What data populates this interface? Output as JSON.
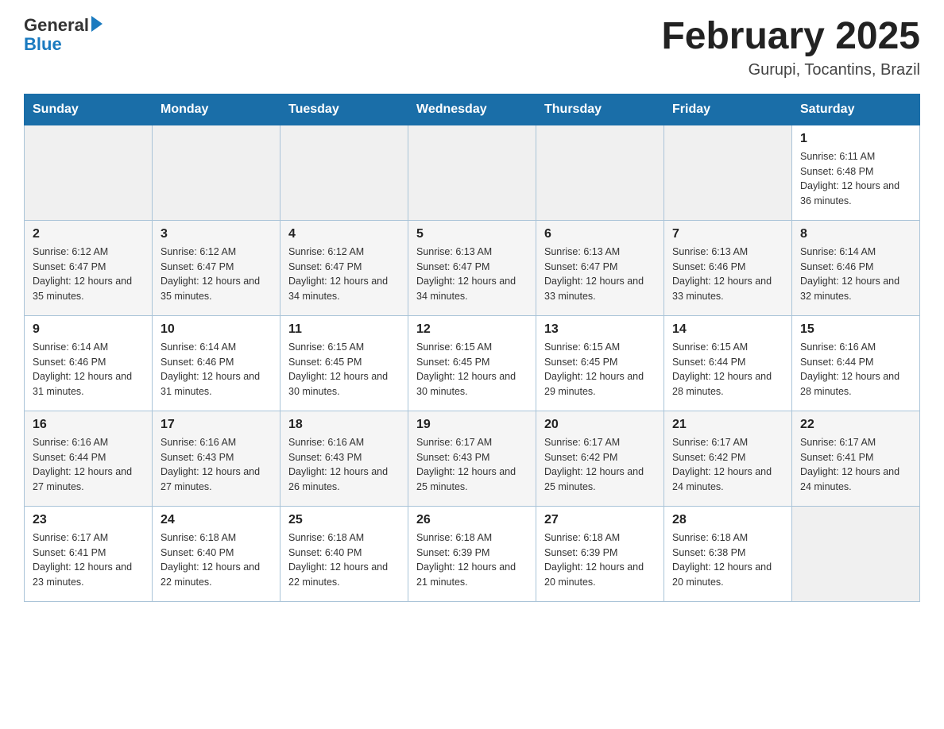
{
  "header": {
    "logo_general": "General",
    "logo_blue": "Blue",
    "month_title": "February 2025",
    "location": "Gurupi, Tocantins, Brazil"
  },
  "weekdays": [
    "Sunday",
    "Monday",
    "Tuesday",
    "Wednesday",
    "Thursday",
    "Friday",
    "Saturday"
  ],
  "weeks": [
    [
      {
        "day": "",
        "info": ""
      },
      {
        "day": "",
        "info": ""
      },
      {
        "day": "",
        "info": ""
      },
      {
        "day": "",
        "info": ""
      },
      {
        "day": "",
        "info": ""
      },
      {
        "day": "",
        "info": ""
      },
      {
        "day": "1",
        "info": "Sunrise: 6:11 AM\nSunset: 6:48 PM\nDaylight: 12 hours and 36 minutes."
      }
    ],
    [
      {
        "day": "2",
        "info": "Sunrise: 6:12 AM\nSunset: 6:47 PM\nDaylight: 12 hours and 35 minutes."
      },
      {
        "day": "3",
        "info": "Sunrise: 6:12 AM\nSunset: 6:47 PM\nDaylight: 12 hours and 35 minutes."
      },
      {
        "day": "4",
        "info": "Sunrise: 6:12 AM\nSunset: 6:47 PM\nDaylight: 12 hours and 34 minutes."
      },
      {
        "day": "5",
        "info": "Sunrise: 6:13 AM\nSunset: 6:47 PM\nDaylight: 12 hours and 34 minutes."
      },
      {
        "day": "6",
        "info": "Sunrise: 6:13 AM\nSunset: 6:47 PM\nDaylight: 12 hours and 33 minutes."
      },
      {
        "day": "7",
        "info": "Sunrise: 6:13 AM\nSunset: 6:46 PM\nDaylight: 12 hours and 33 minutes."
      },
      {
        "day": "8",
        "info": "Sunrise: 6:14 AM\nSunset: 6:46 PM\nDaylight: 12 hours and 32 minutes."
      }
    ],
    [
      {
        "day": "9",
        "info": "Sunrise: 6:14 AM\nSunset: 6:46 PM\nDaylight: 12 hours and 31 minutes."
      },
      {
        "day": "10",
        "info": "Sunrise: 6:14 AM\nSunset: 6:46 PM\nDaylight: 12 hours and 31 minutes."
      },
      {
        "day": "11",
        "info": "Sunrise: 6:15 AM\nSunset: 6:45 PM\nDaylight: 12 hours and 30 minutes."
      },
      {
        "day": "12",
        "info": "Sunrise: 6:15 AM\nSunset: 6:45 PM\nDaylight: 12 hours and 30 minutes."
      },
      {
        "day": "13",
        "info": "Sunrise: 6:15 AM\nSunset: 6:45 PM\nDaylight: 12 hours and 29 minutes."
      },
      {
        "day": "14",
        "info": "Sunrise: 6:15 AM\nSunset: 6:44 PM\nDaylight: 12 hours and 28 minutes."
      },
      {
        "day": "15",
        "info": "Sunrise: 6:16 AM\nSunset: 6:44 PM\nDaylight: 12 hours and 28 minutes."
      }
    ],
    [
      {
        "day": "16",
        "info": "Sunrise: 6:16 AM\nSunset: 6:44 PM\nDaylight: 12 hours and 27 minutes."
      },
      {
        "day": "17",
        "info": "Sunrise: 6:16 AM\nSunset: 6:43 PM\nDaylight: 12 hours and 27 minutes."
      },
      {
        "day": "18",
        "info": "Sunrise: 6:16 AM\nSunset: 6:43 PM\nDaylight: 12 hours and 26 minutes."
      },
      {
        "day": "19",
        "info": "Sunrise: 6:17 AM\nSunset: 6:43 PM\nDaylight: 12 hours and 25 minutes."
      },
      {
        "day": "20",
        "info": "Sunrise: 6:17 AM\nSunset: 6:42 PM\nDaylight: 12 hours and 25 minutes."
      },
      {
        "day": "21",
        "info": "Sunrise: 6:17 AM\nSunset: 6:42 PM\nDaylight: 12 hours and 24 minutes."
      },
      {
        "day": "22",
        "info": "Sunrise: 6:17 AM\nSunset: 6:41 PM\nDaylight: 12 hours and 24 minutes."
      }
    ],
    [
      {
        "day": "23",
        "info": "Sunrise: 6:17 AM\nSunset: 6:41 PM\nDaylight: 12 hours and 23 minutes."
      },
      {
        "day": "24",
        "info": "Sunrise: 6:18 AM\nSunset: 6:40 PM\nDaylight: 12 hours and 22 minutes."
      },
      {
        "day": "25",
        "info": "Sunrise: 6:18 AM\nSunset: 6:40 PM\nDaylight: 12 hours and 22 minutes."
      },
      {
        "day": "26",
        "info": "Sunrise: 6:18 AM\nSunset: 6:39 PM\nDaylight: 12 hours and 21 minutes."
      },
      {
        "day": "27",
        "info": "Sunrise: 6:18 AM\nSunset: 6:39 PM\nDaylight: 12 hours and 20 minutes."
      },
      {
        "day": "28",
        "info": "Sunrise: 6:18 AM\nSunset: 6:38 PM\nDaylight: 12 hours and 20 minutes."
      },
      {
        "day": "",
        "info": ""
      }
    ]
  ]
}
